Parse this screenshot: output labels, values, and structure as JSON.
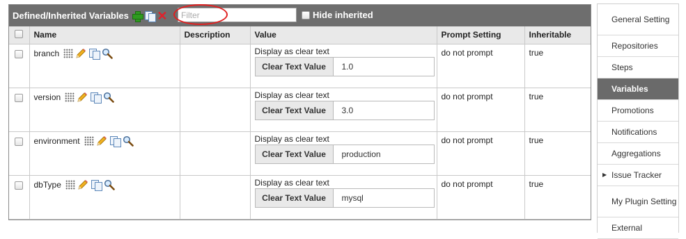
{
  "panel": {
    "title": "Defined/Inherited Variables",
    "filter_placeholder": "Filter",
    "hide_inherited_label": "Hide inherited"
  },
  "table": {
    "headers": {
      "name": "Name",
      "description": "Description",
      "value": "Value",
      "prompt": "Prompt Setting",
      "inheritable": "Inheritable"
    },
    "rows": [
      {
        "name": "branch",
        "description": "",
        "display_mode": "Display as clear text",
        "value_button": "Clear Text Value",
        "value": "1.0",
        "prompt": "do not prompt",
        "inheritable": "true"
      },
      {
        "name": "version",
        "description": "",
        "display_mode": "Display as clear text",
        "value_button": "Clear Text Value",
        "value": "3.0",
        "prompt": "do not prompt",
        "inheritable": "true"
      },
      {
        "name": "environment",
        "description": "",
        "display_mode": "Display as clear text",
        "value_button": "Clear Text Value",
        "value": "production",
        "prompt": "do not prompt",
        "inheritable": "true"
      },
      {
        "name": "dbType",
        "description": "",
        "display_mode": "Display as clear text",
        "value_button": "Clear Text Value",
        "value": "mysql",
        "prompt": "do not prompt",
        "inheritable": "true"
      }
    ]
  },
  "sidenav": {
    "items": [
      {
        "label": "General Setting"
      },
      {
        "label": "Repositories"
      },
      {
        "label": "Steps"
      },
      {
        "label": "Variables",
        "active": true
      },
      {
        "label": "Promotions"
      },
      {
        "label": "Notifications"
      },
      {
        "label": "Aggregations"
      },
      {
        "label": "Issue Tracker"
      },
      {
        "label": "My Plugin Setting"
      },
      {
        "label": "External"
      }
    ]
  },
  "colors": {
    "toolbar_bg": "#6e6e6e",
    "active_nav_bg": "#6a6a6a",
    "add_icon": "#2e9b1f",
    "delete_icon": "#e0212b",
    "highlight_circle": "#e02020"
  },
  "icons": [
    "add-icon",
    "copy-icon",
    "delete-icon",
    "drag-handle-icon",
    "edit-icon",
    "search-icon",
    "chevron-right-icon"
  ]
}
